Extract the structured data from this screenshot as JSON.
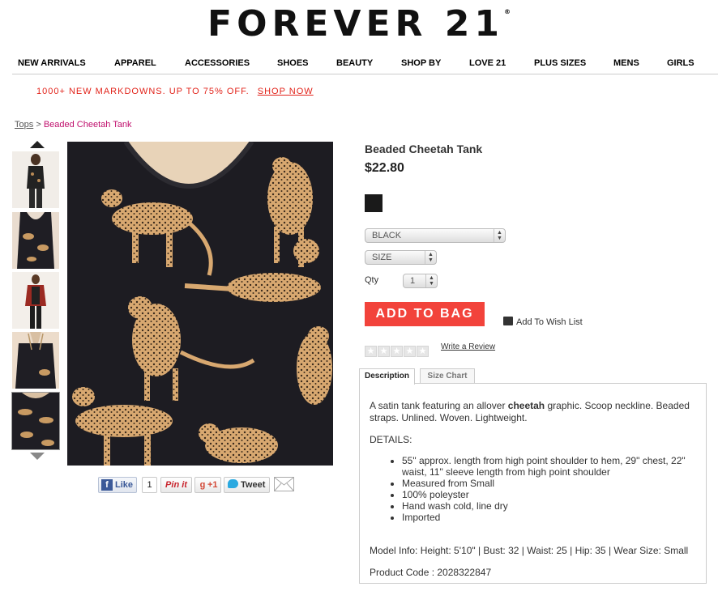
{
  "brand": {
    "name": "FOREVER 21",
    "mark": "®"
  },
  "nav": [
    "NEW ARRIVALS",
    "APPAREL",
    "ACCESSORIES",
    "SHOES",
    "BEAUTY",
    "SHOP BY",
    "LOVE 21",
    "PLUS SIZES",
    "MENS",
    "GIRLS"
  ],
  "promo": {
    "text": "1000+ NEW MARKDOWNS. UP TO 75% OFF.",
    "link": "SHOP NOW"
  },
  "breadcrumb": {
    "parent": "Tops",
    "separator": ">",
    "current": "Beaded Cheetah Tank"
  },
  "product": {
    "title": "Beaded Cheetah Tank",
    "price": "$22.80",
    "color_select": "BLACK",
    "size_select": "SIZE",
    "qty_label": "Qty",
    "qty_value": "1",
    "add_to_bag": "ADD TO BAG",
    "wish_list": "Add To Wish List",
    "write_review": "Write a Review",
    "rating": 0
  },
  "social": {
    "like": "Like",
    "like_count": "1",
    "pin": "Pin it",
    "plus": "+1",
    "tweet": "Tweet"
  },
  "tabs": [
    "Description",
    "Size Chart"
  ],
  "description": {
    "intro_pre": "A satin tank featuring an allover ",
    "intro_bold": "cheetah",
    "intro_post": " graphic. Scoop neckline. Beaded straps. Unlined. Woven. Lightweight.",
    "details_heading": "DETAILS:",
    "details": [
      "55\" approx. length from high point shoulder to hem, 29\" chest, 22\" waist, 11\" sleeve length from high point shoulder",
      "Measured from Small",
      "100% poleyster",
      "Hand wash cold, line dry",
      "Imported"
    ],
    "model_info": "Model Info: Height: 5'10\" | Bust: 32 | Waist: 25 | Hip: 35 | Wear Size: Small",
    "product_code": "Product Code : 2028322847"
  },
  "colors": {
    "accent": "#f2433b",
    "promo": "#e2231a",
    "breadcrumb_current": "#c0106d",
    "swatch": "#1a1a1a"
  }
}
